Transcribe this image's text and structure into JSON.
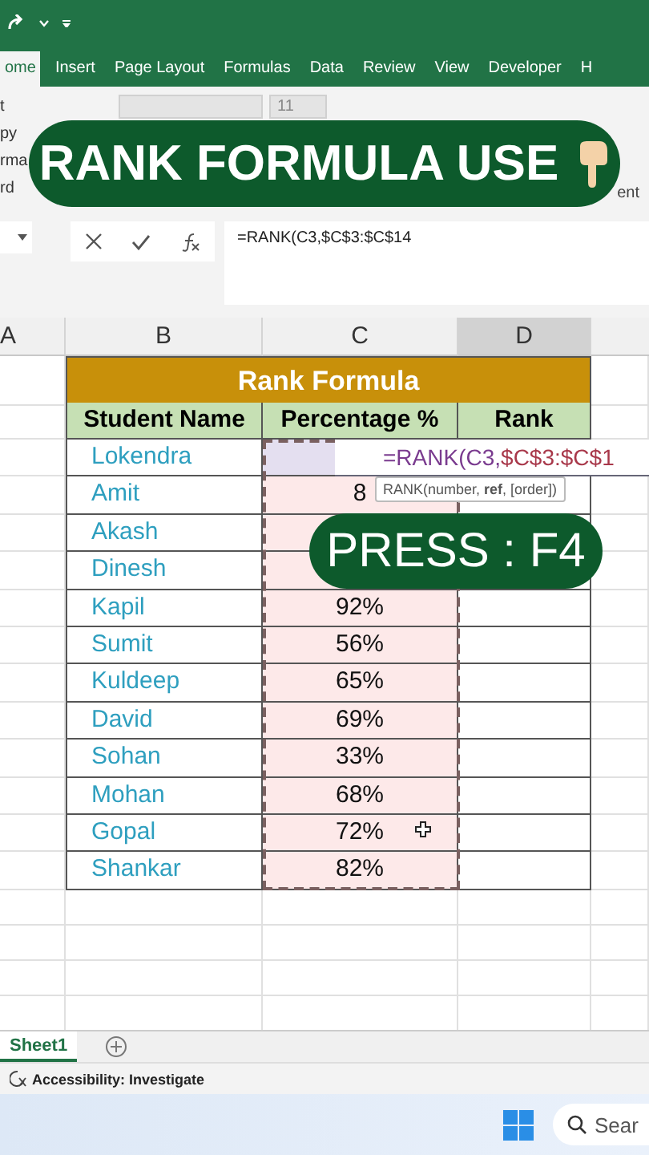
{
  "ribbon": {
    "tabs": [
      {
        "label": "ome",
        "selected": true
      },
      {
        "label": "Insert",
        "selected": false
      },
      {
        "label": "Page Layout",
        "selected": false
      },
      {
        "label": "Formulas",
        "selected": false
      },
      {
        "label": "Data",
        "selected": false
      },
      {
        "label": "Review",
        "selected": false
      },
      {
        "label": "View",
        "selected": false
      },
      {
        "label": "Developer",
        "selected": false
      },
      {
        "label": "H",
        "selected": false
      }
    ],
    "clipboard_labels": [
      "t",
      "py",
      "rma",
      "rd"
    ],
    "font_size": "11",
    "group_label": "ent"
  },
  "banner": {
    "text": "RANK FORMULA USE"
  },
  "formula_bar": {
    "formula": "=RANK(C3,$C$3:$C$14"
  },
  "columns": [
    {
      "label": "A",
      "selected": false
    },
    {
      "label": "B",
      "selected": false
    },
    {
      "label": "C",
      "selected": false
    },
    {
      "label": "D",
      "selected": true
    }
  ],
  "table": {
    "title": "Rank Formula",
    "headers": [
      "Student Name",
      "Percentage %",
      "Rank"
    ],
    "rows": [
      {
        "name": "Lokendra",
        "selected": true
      },
      {
        "name": "Amit",
        "percentage": "8",
        "selected": false
      },
      {
        "name": "Akash",
        "selected": false
      },
      {
        "name": "Dinesh",
        "selected": false
      },
      {
        "name": "Kapil",
        "percentage": "92%",
        "selected": false
      },
      {
        "name": "Sumit",
        "percentage": "56%",
        "selected": false
      },
      {
        "name": "Kuldeep",
        "percentage": "65%",
        "selected": false
      },
      {
        "name": "David",
        "percentage": "69%",
        "selected": false
      },
      {
        "name": "Sohan",
        "percentage": "33%",
        "selected": false
      },
      {
        "name": "Mohan",
        "percentage": "68%",
        "selected": false
      },
      {
        "name": "Gopal",
        "percentage": "72%",
        "selected": false
      },
      {
        "name": "Shankar",
        "percentage": "82%",
        "selected": false
      }
    ]
  },
  "cell_editor": {
    "parts": [
      {
        "text": "=RANK(C3,",
        "color": "#7a3b8f"
      },
      {
        "text": "$C$3:$C$1",
        "color": "#a8384a"
      }
    ]
  },
  "tooltip": "RANK(number, **ref**, [order])",
  "callout": "PRESS : F4",
  "sheet_tabs": [
    {
      "label": "Sheet1",
      "selected": true
    }
  ],
  "status_bar": {
    "text": "Accessibility: Investigate"
  },
  "taskbar": {
    "search_placeholder": "Sear"
  }
}
